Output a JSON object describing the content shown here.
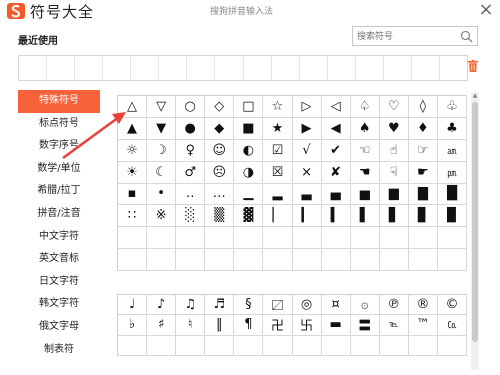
{
  "header": {
    "title": "符号大全",
    "caption": "搜狗拼音输入法",
    "close_label": "×"
  },
  "recent": {
    "label": "最近使用",
    "slot_count": 16
  },
  "search": {
    "placeholder": "搜索符号"
  },
  "sidebar": {
    "items": [
      {
        "label": "特殊符号",
        "active": true
      },
      {
        "label": "标点符号",
        "active": false
      },
      {
        "label": "数字序号",
        "active": false
      },
      {
        "label": "数学/单位",
        "active": false
      },
      {
        "label": "希腊/拉丁",
        "active": false
      },
      {
        "label": "拼音/注音",
        "active": false
      },
      {
        "label": "中文字符",
        "active": false
      },
      {
        "label": "英文音标",
        "active": false
      },
      {
        "label": "日文字符",
        "active": false
      },
      {
        "label": "韩文字符",
        "active": false
      },
      {
        "label": "俄文字母",
        "active": false
      },
      {
        "label": "制表符",
        "active": false
      }
    ]
  },
  "symbols_main": [
    [
      "△",
      "▽",
      "○",
      "◇",
      "□",
      "☆",
      "▷",
      "◁",
      "♤",
      "♡",
      "◊",
      "♧"
    ],
    [
      "▲",
      "▼",
      "●",
      "◆",
      "■",
      "★",
      "▶",
      "◀",
      "♠",
      "♥",
      "♦",
      "♣"
    ],
    [
      "☼",
      "☽",
      "♀",
      "☺",
      "◐",
      "☑",
      "√",
      "✔",
      "☜",
      "☝",
      "☞",
      "㏂"
    ],
    [
      "☀",
      "☾",
      "♂",
      "☹",
      "◑",
      "☒",
      "×",
      "✘",
      "☚",
      "☟",
      "☛",
      "㏘"
    ],
    [
      "▪",
      "•",
      "‥",
      "…",
      "▁",
      "▂",
      "▃",
      "▄",
      "▅",
      "▆",
      "▇",
      "█"
    ],
    [
      "∷",
      "※",
      "░",
      "▒",
      "▓",
      "▏",
      "▎",
      "▍",
      "▌",
      "▋",
      "▊",
      "▉"
    ],
    [
      "",
      "",
      "",
      "",
      "",
      "",
      "",
      "",
      "",
      "",
      "",
      ""
    ],
    [
      "",
      "",
      "",
      "",
      "",
      "",
      "",
      "",
      "",
      "",
      "",
      ""
    ]
  ],
  "symbols_music": [
    [
      "♩",
      "♪",
      "♫",
      "♬",
      "§",
      "〼",
      "◎",
      "¤",
      "۞",
      "℗",
      "®",
      "©"
    ],
    [
      "♭",
      "♯",
      "♮",
      "‖",
      "¶",
      "卍",
      "卐",
      "▬",
      "〓",
      "℡",
      "™",
      "㏇"
    ],
    [
      "",
      "",
      "",
      "",
      "",
      "",
      "",
      "",
      "",
      "",
      "",
      ""
    ]
  ],
  "colors": {
    "accent": "#f7623b",
    "annotation": "#e8413c"
  }
}
